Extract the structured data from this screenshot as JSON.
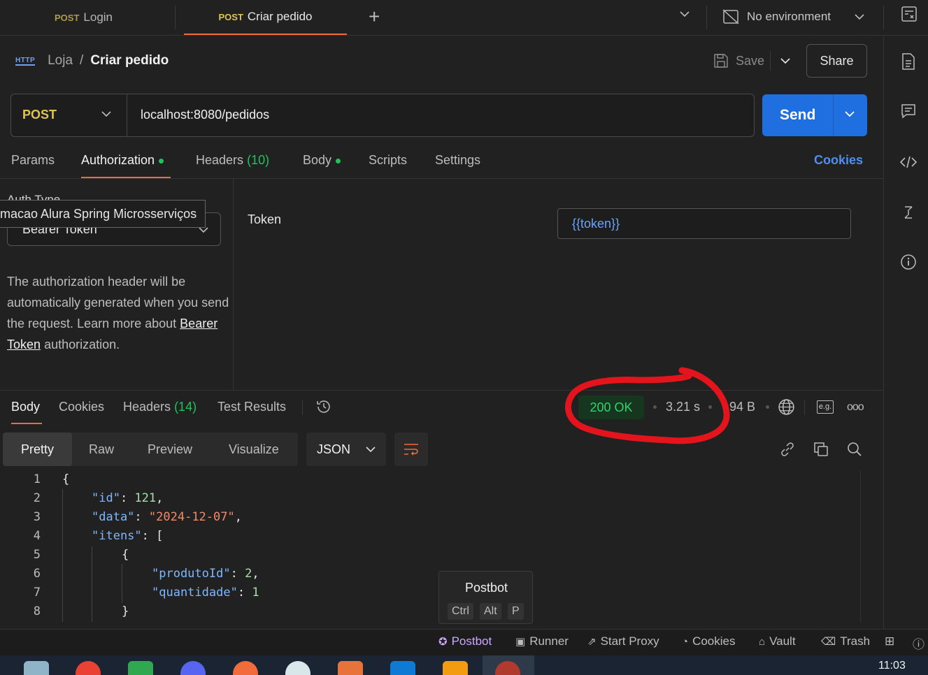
{
  "tabs": [
    {
      "method": "POST",
      "name": "Login"
    },
    {
      "method": "POST",
      "name": "Criar pedido"
    }
  ],
  "environment": {
    "label": "No environment"
  },
  "breadcrumb": {
    "collection": "Loja",
    "separator": "/",
    "request": "Criar pedido",
    "http_badge": "HTTP"
  },
  "header": {
    "save_label": "Save",
    "share_label": "Share"
  },
  "request": {
    "method": "POST",
    "url": "localhost:8080/pedidos",
    "send_label": "Send"
  },
  "request_tabs": {
    "params": "Params",
    "authorization": "Authorization",
    "headers": "Headers",
    "headers_count": "(10)",
    "body": "Body",
    "scripts": "Scripts",
    "settings": "Settings",
    "cookies": "Cookies"
  },
  "auth": {
    "type_label": "Auth Type",
    "type_value": "Bearer Token",
    "tooltip": "macao Alura Spring Microsserviços",
    "description": "The authorization header will be automatically generated when you send the request. Learn more about",
    "link": "Bearer Token",
    "suffix": "authorization.",
    "token_label": "Token",
    "token_value": "{{token}}"
  },
  "response_tabs": {
    "body": "Body",
    "cookies": "Cookies",
    "headers": "Headers",
    "headers_count": "(14)",
    "test_results": "Test Results"
  },
  "response_meta": {
    "status": "200 OK",
    "time": "3.21 s",
    "size": "94 B",
    "eg": "e.g."
  },
  "format": {
    "pretty": "Pretty",
    "raw": "Raw",
    "preview": "Preview",
    "visualize": "Visualize",
    "language": "JSON"
  },
  "code_lines": [
    "1",
    "2",
    "3",
    "4",
    "5",
    "6",
    "7",
    "8"
  ],
  "code_tokens": {
    "l1": "{",
    "k_id": "\"id\"",
    "v_id": "121",
    "k_data": "\"data\"",
    "v_data": "\"2024-12-07\"",
    "k_itens": "\"itens\"",
    "open_arr": "[",
    "open_obj": "{",
    "k_prod": "\"produtoId\"",
    "v_prod": "2",
    "k_qtd": "\"quantidade\"",
    "v_qtd": "1",
    "close_obj": "}"
  },
  "postbot_popover": {
    "title": "Postbot",
    "keys": [
      "Ctrl",
      "Alt",
      "P"
    ]
  },
  "statusbar": {
    "postbot": "Postbot",
    "runner": "Runner",
    "proxy": "Start Proxy",
    "cookies": "Cookies",
    "vault": "Vault",
    "trash": "Trash"
  },
  "taskbar": {
    "clock": "11:03"
  },
  "colors": {
    "accent": "#f26b3a",
    "send": "#1f6fe0",
    "method": "#e0c259",
    "status_ok": "#2fd36b",
    "annotation": "#e3141c"
  }
}
